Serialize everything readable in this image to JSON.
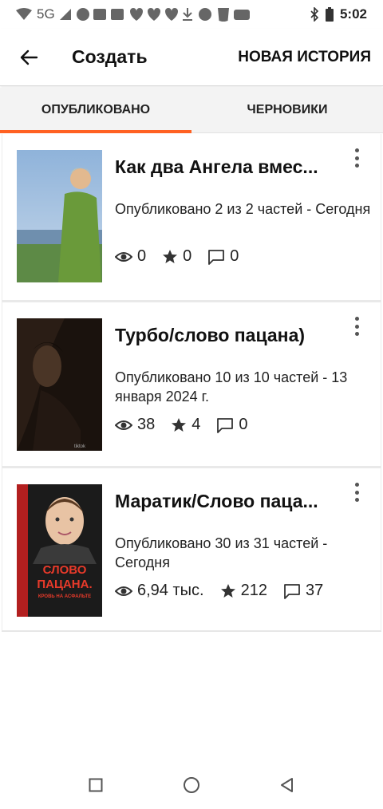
{
  "status_bar": {
    "network": "5G",
    "time": "5:02",
    "icons": [
      "wifi-icon",
      "signal-icon",
      "vk-icon",
      "message-icon",
      "vk-icon",
      "heart-icon",
      "heart-icon",
      "heart-icon",
      "download-icon",
      "pinterest-icon",
      "html5-icon",
      "youtube-icon",
      "bluetooth-icon",
      "battery-icon"
    ]
  },
  "appbar": {
    "title": "Создать",
    "new_story_label": "НОВАЯ ИСТОРИЯ"
  },
  "tabs": [
    {
      "label": "ОПУБЛИКОВАНО",
      "active": true
    },
    {
      "label": "ЧЕРНОВИКИ",
      "active": false
    }
  ],
  "stories": [
    {
      "title": "Как два Ангела вмес...",
      "meta": "Опубликовано 2 из 2 частей - Сегодня",
      "views": "0",
      "votes": "0",
      "comments": "0"
    },
    {
      "title": "Турбо/слово пацана)",
      "meta": "Опубликовано 10 из 10 частей - 13 января 2024 г.",
      "views": "38",
      "votes": "4",
      "comments": "0"
    },
    {
      "title": "Маратик/Слово паца...",
      "meta": "Опубликовано 30 из 31 частей - Сегодня",
      "views": "6,94 тыс.",
      "votes": "212",
      "comments": "37",
      "cover_text": {
        "top": "СЛОВО",
        "middle": "ПАЦАНА.",
        "bottom": "КРОВЬ НА АСФАЛЬТЕ"
      }
    }
  ],
  "colors": {
    "accent": "#ff6122",
    "tab_bg": "#f3f3f3"
  }
}
